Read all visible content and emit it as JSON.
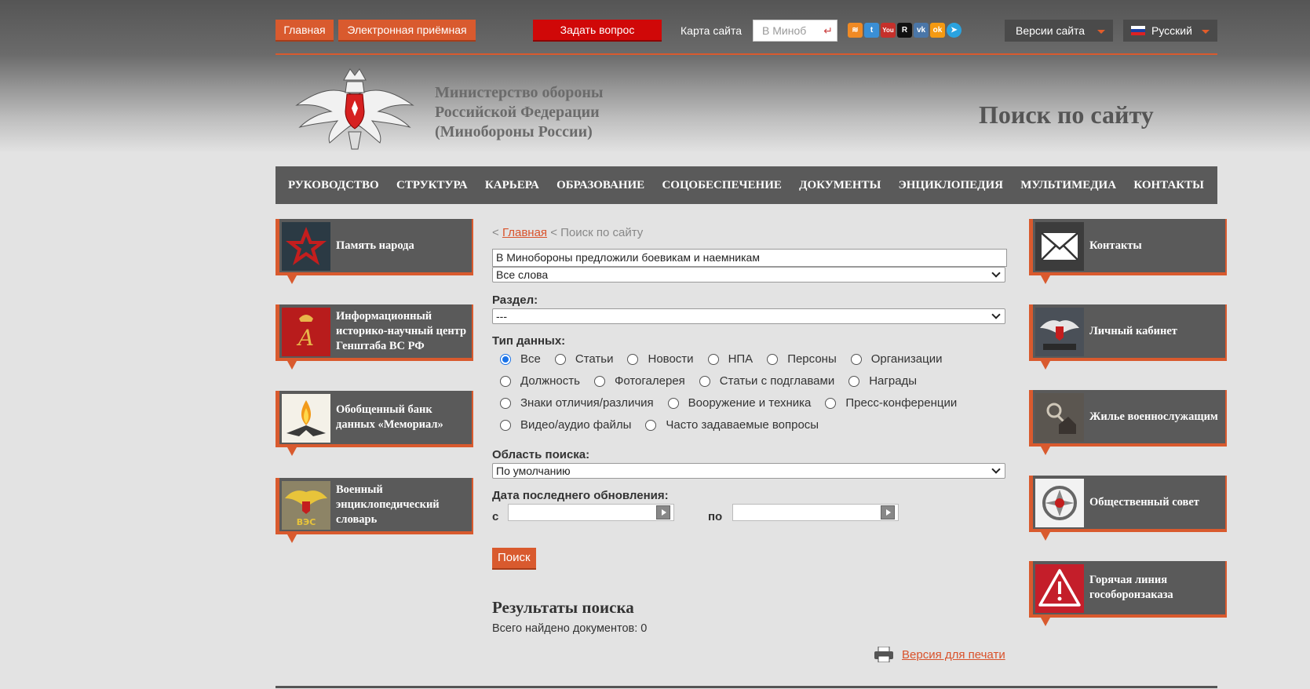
{
  "topbar": {
    "home": "Главная",
    "reception": "Электронная приёмная",
    "ask": "Задать вопрос",
    "sitemap": "Карта сайта",
    "search_placeholder": "В Миноб",
    "versions": "Версии сайта",
    "language": "Русский",
    "socials": [
      "rss-icon",
      "twitter-icon",
      "youtube-icon",
      "rutube-icon",
      "vk-icon",
      "ok-icon",
      "telegram-icon"
    ]
  },
  "header": {
    "ministry_line1": "Министерство обороны",
    "ministry_line2": "Российской Федерации",
    "ministry_line3": "(Минобороны России)",
    "page_title": "Поиск по сайту"
  },
  "nav": [
    "РУКОВОДСТВО",
    "СТРУКТУРА",
    "КАРЬЕРА",
    "ОБРАЗОВАНИЕ",
    "СОЦОБЕСПЕЧЕНИЕ",
    "ДОКУМЕНТЫ",
    "ЭНЦИКЛОПЕДИЯ",
    "МУЛЬТИМЕДИА",
    "КОНТАКТЫ"
  ],
  "left_tiles": [
    {
      "label": "Память народа",
      "icon": "red-star-icon"
    },
    {
      "label": "Информационный историко-научный центр Генштаба ВС РФ",
      "icon": "monogram-icon"
    },
    {
      "label": "Обобщенный банк данных «Мемориал»",
      "icon": "eternal-flame-icon"
    },
    {
      "label": "Военный энциклопедический словарь",
      "icon": "ves-emblem-icon"
    }
  ],
  "right_tiles": [
    {
      "label": "Контакты",
      "icon": "envelope-icon"
    },
    {
      "label": "Личный кабинет",
      "icon": "cabinet-icon"
    },
    {
      "label": "Жилье военнослужащим",
      "icon": "keys-icon"
    },
    {
      "label": "Общественный совет",
      "icon": "council-emblem-icon"
    },
    {
      "label": "Горячая линия гособоронзаказа",
      "icon": "warning-icon"
    }
  ],
  "breadcrumb": {
    "prefix": "<",
    "home": "Главная",
    "sep": "<",
    "current": "Поиск по сайту"
  },
  "search": {
    "query": "В Минобороны предложили боевикам и наемникам",
    "words_mode": "Все слова",
    "section_label": "Раздел:",
    "section_value": "---",
    "type_label": "Тип данных:",
    "types_row1": [
      "Все",
      "Статьи",
      "Новости",
      "НПА",
      "Персоны",
      "Организации"
    ],
    "types_row2": [
      "Должность",
      "Фотогалерея",
      "Статьи с подглавами",
      "Награды"
    ],
    "types_row3": [
      "Знаки отличия/различия",
      "Вооружение и техника",
      "Пресс-конференции"
    ],
    "types_row4": [
      "Видео/аудио файлы",
      "Часто задаваемые вопросы"
    ],
    "selected_type": "Все",
    "area_label": "Область поиска:",
    "area_value": "По умолчанию",
    "date_label": "Дата последнего обновления:",
    "from_label": "с",
    "to_label": "по",
    "button": "Поиск"
  },
  "results": {
    "heading": "Результаты поиска",
    "count_text": "Всего найдено документов: 0",
    "print_link": "Версия для печати"
  }
}
